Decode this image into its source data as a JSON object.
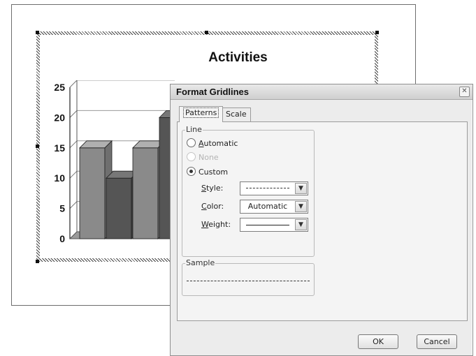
{
  "slide": {
    "chart_title": "Activities",
    "y_axis_ticks": [
      "25",
      "20",
      "15",
      "10",
      "5",
      "0"
    ]
  },
  "chart_data": {
    "type": "bar",
    "title": "Activities",
    "ylim": [
      0,
      25
    ],
    "yticks": [
      0,
      5,
      10,
      15,
      20,
      25
    ],
    "values": [
      15,
      10,
      15,
      20
    ],
    "grid": true
  },
  "dialog": {
    "title": "Format Gridlines",
    "close_symbol": "✕",
    "tabs": {
      "patterns": "Patterns",
      "scale": "Scale"
    },
    "line_group": {
      "label": "Line",
      "automatic": {
        "underline": "A",
        "rest": "utomatic"
      },
      "none": "None",
      "custom": "Custom",
      "style": {
        "underline": "S",
        "rest": "tyle:"
      },
      "color": {
        "underline": "C",
        "rest": "olor:"
      },
      "weight": {
        "underline": "W",
        "rest": "eight:"
      },
      "color_value": "Automatic",
      "selected": "Custom"
    },
    "sample_group": {
      "label": "Sample"
    },
    "buttons": {
      "ok": "OK",
      "cancel": "Cancel"
    }
  }
}
